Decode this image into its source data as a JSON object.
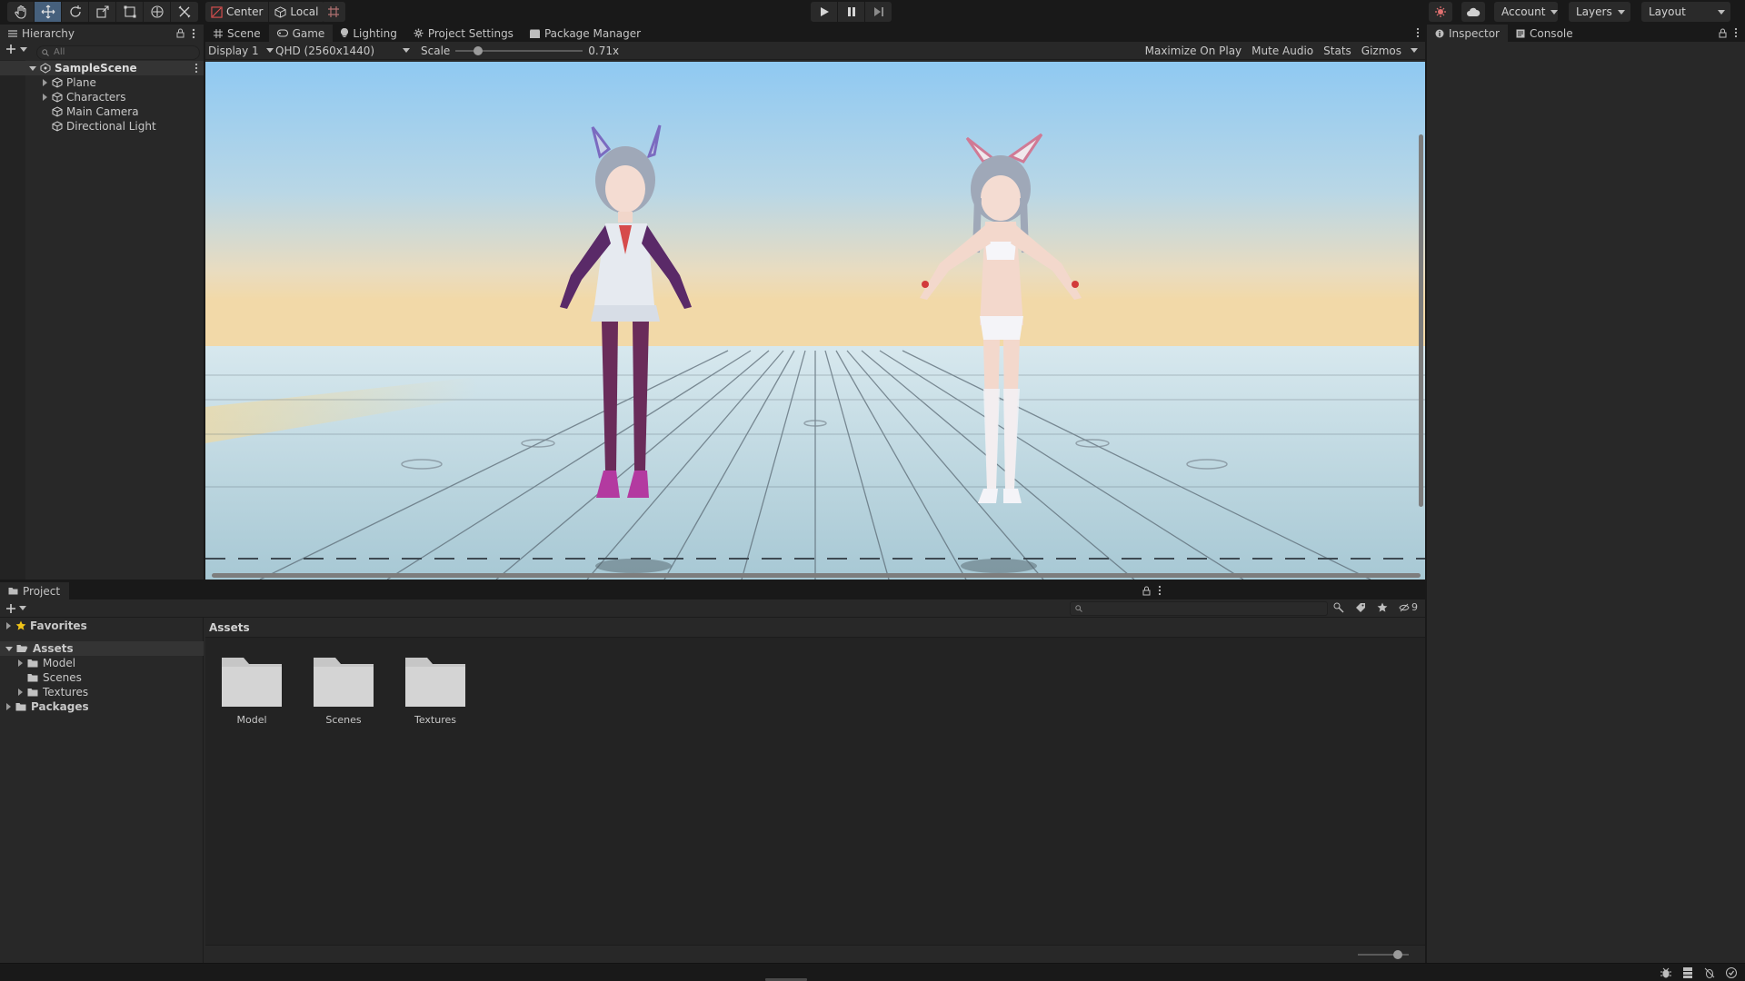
{
  "toolbar": {
    "tools": [
      "hand-tool",
      "move-tool",
      "rotate-tool",
      "scale-tool",
      "rect-tool",
      "transform-tool",
      "custom-tool"
    ],
    "pivot_mode": "Center",
    "pivot_rotation": "Local",
    "account_label": "Account",
    "layers_label": "Layers",
    "layout_label": "Layout"
  },
  "hierarchy": {
    "tab_label": "Hierarchy",
    "search_placeholder": "All",
    "scene_name": "SampleScene",
    "items": [
      {
        "label": "Plane",
        "expandable": true
      },
      {
        "label": "Characters",
        "expandable": true
      },
      {
        "label": "Main Camera",
        "expandable": false
      },
      {
        "label": "Directional Light",
        "expandable": false
      }
    ]
  },
  "center_tabs": [
    "Scene",
    "Game",
    "Lighting",
    "Project Settings",
    "Package Manager"
  ],
  "active_center_tab": "Game",
  "game_view": {
    "display": "Display 1",
    "resolution": "QHD (2560x1440)",
    "scale_label": "Scale",
    "scale_value": "0.71x",
    "scale_fraction": 0.15,
    "maximize_on_play": "Maximize On Play",
    "mute_audio": "Mute Audio",
    "stats": "Stats",
    "gizmos": "Gizmos"
  },
  "right_tabs": {
    "inspector": "Inspector",
    "console": "Console"
  },
  "project": {
    "tab_label": "Project",
    "favorites_label": "Favorites",
    "assets_label": "Assets",
    "asset_folders": [
      "Model",
      "Scenes",
      "Textures"
    ],
    "packages_label": "Packages",
    "hidden_count": "9",
    "breadcrumb": "Assets",
    "zoom_fraction": 0.85
  },
  "colors": {
    "accent_blue": "#46607c",
    "panel_bg": "#282828",
    "toolbar_bg": "#191919",
    "sky_top": "#8fc9f2",
    "sky_horizon": "#f2d9a8"
  }
}
